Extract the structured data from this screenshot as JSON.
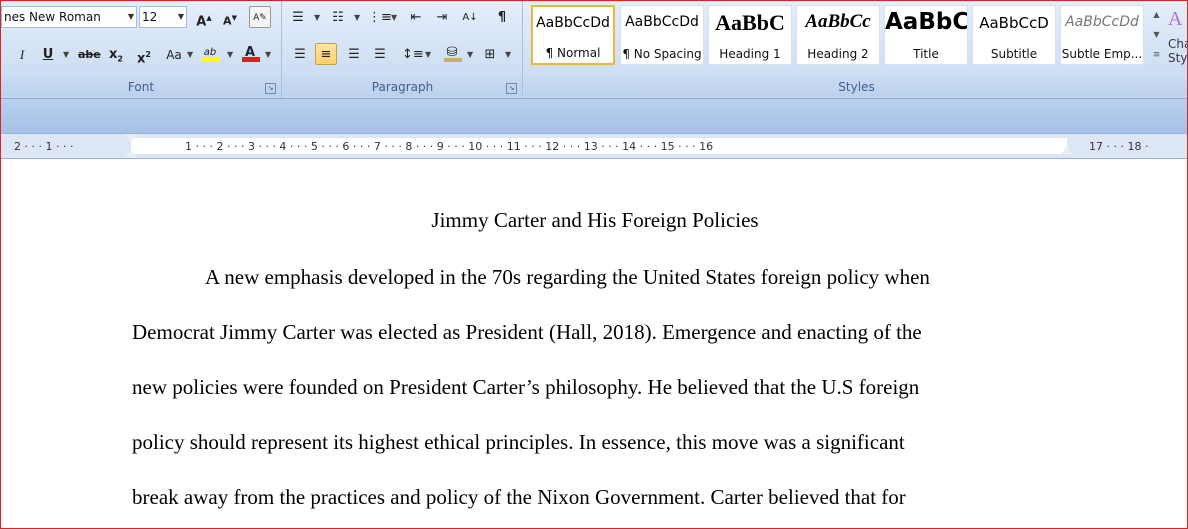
{
  "ribbon": {
    "font_group": {
      "label": "Font",
      "font_name": "nes New Roman",
      "font_size": "12",
      "grow_font": "A",
      "shrink_font": "A",
      "bold": "B",
      "italic": "I",
      "underline": "U",
      "strikethrough": "abe",
      "subscript": "x",
      "superscript": "x",
      "change_case": "Aa",
      "highlight": "ab",
      "font_color": "A"
    },
    "paragraph_group": {
      "label": "Paragraph",
      "show_marks": "¶"
    },
    "styles_group": {
      "label": "Styles",
      "styles": [
        {
          "sample": "AaBbCcDd",
          "name": "¶ Normal"
        },
        {
          "sample": "AaBbCcDd",
          "name": "¶ No Spacing"
        },
        {
          "sample": "AaBbC",
          "name": "Heading 1"
        },
        {
          "sample": "AaBbCc",
          "name": "Heading 2"
        },
        {
          "sample": "AaBbC",
          "name": "Title"
        },
        {
          "sample": "AaBbCcD",
          "name": "Subtitle"
        },
        {
          "sample": "AaBbCcDd",
          "name": "Subtle Emp..."
        }
      ],
      "change_styles_label_1": "Cha",
      "change_styles_label_2": "Sty"
    }
  },
  "ruler": {
    "left_text": "2 · · · 1 · · ·",
    "main_text": "1 · · · 2 · · · 3 · · · 4 · · · 5 · · · 6 · · · 7 · · · 8 · · · 9 · · · 10 · · · 11 · · · 12 · · · 13 · · · 14 · · · 15 · · · 16",
    "right_text": "17 · · · 18 ·"
  },
  "document": {
    "title": "Jimmy Carter and His Foreign Policies",
    "lines": [
      "A new emphasis developed in the 70s regarding the United States foreign policy when",
      "Democrat Jimmy Carter was elected as President (Hall, 2018). Emergence and enacting of the",
      "new policies were founded on President Carter’s philosophy.  He believed that the U.S foreign",
      "policy should represent its highest ethical principles. In essence, this move was a significant",
      "break away from the practices and policy of the Nixon Government. Carter believed that for"
    ]
  }
}
